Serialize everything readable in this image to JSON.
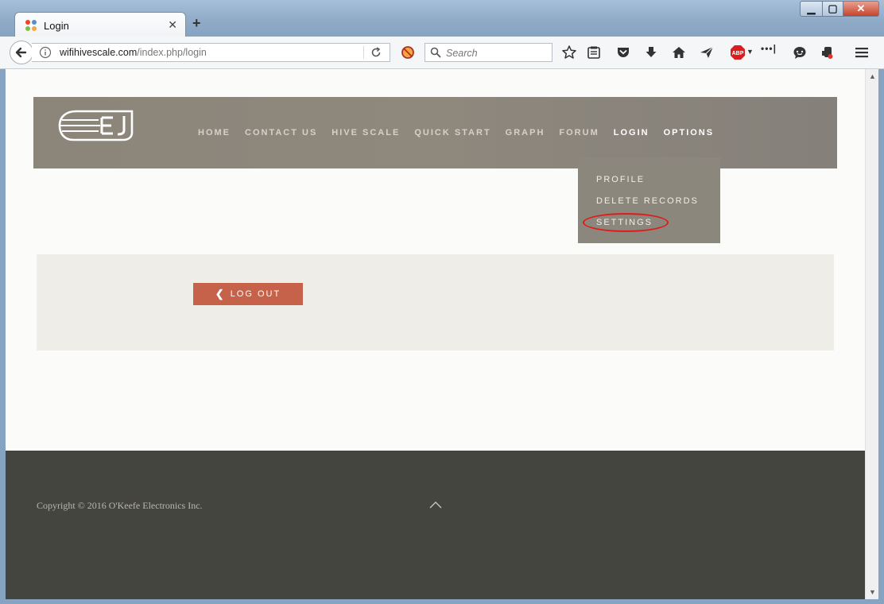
{
  "browser": {
    "tab_title": "Login",
    "url_domain": "wifihivescale.com",
    "url_path": "/index.php/login",
    "search_placeholder": "Search"
  },
  "site": {
    "menu": [
      {
        "label": "HOME"
      },
      {
        "label": "CONTACT US"
      },
      {
        "label": "HIVE SCALE"
      },
      {
        "label": "QUICK START"
      },
      {
        "label": "GRAPH"
      },
      {
        "label": "FORUM"
      },
      {
        "label": "LOGIN"
      },
      {
        "label": "OPTIONS"
      }
    ],
    "dropdown": [
      {
        "label": "PROFILE"
      },
      {
        "label": "DELETE RECORDS"
      },
      {
        "label": "SETTINGS"
      }
    ],
    "logout_label": "LOG OUT",
    "footer_copyright": "Copyright © 2016 O'Keefe Electronics Inc."
  },
  "colors": {
    "header": "#8c857a",
    "logout": "#c6614a",
    "footer": "#454540",
    "highlight": "#e01b1b"
  }
}
